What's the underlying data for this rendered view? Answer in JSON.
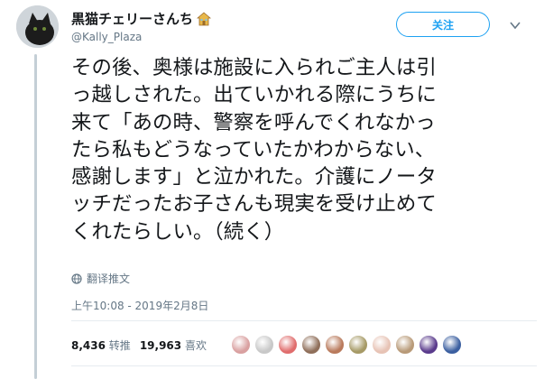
{
  "user": {
    "display_name": "黒猫チェリーさんち",
    "handle": "@Kally_Plaza",
    "name_emoji_icon": "house-icon"
  },
  "follow_button": {
    "label": "关注"
  },
  "tweet": {
    "text": "その後、奥様は施設に入られご主人は引\nっ越しされた。出ていかれる際にうちに\n来て「あの時、警察を呼んでくれなかっ\nたら私もどうなっていたかわからない、\n感謝します」と泣かれた。介護にノータ\nッチだったお子さんも現実を受け止めて\nくれたらしい。（続く）"
  },
  "translate": {
    "label": "翻译推文",
    "icon": "globe-icon"
  },
  "timestamp": "上午10:08 - 2019年2月8日",
  "stats": {
    "retweets_count": "8,436",
    "retweets_label": "转推",
    "likes_count": "19,963",
    "likes_label": "喜欢"
  },
  "liker_avatars": [
    {
      "color": "#d9a0a0"
    },
    {
      "color": "#c8c8c8"
    },
    {
      "color": "#e06d6d"
    },
    {
      "color": "#8f6f5a"
    },
    {
      "color": "#b97a5c"
    },
    {
      "color": "#a69a66"
    },
    {
      "color": "#e7c3b5"
    },
    {
      "color": "#b89a78"
    },
    {
      "color": "#5a3b8c"
    },
    {
      "color": "#3b5fa0"
    }
  ],
  "colors": {
    "accent": "#1da1f2",
    "text": "#14171a",
    "secondary_text": "#657786"
  }
}
